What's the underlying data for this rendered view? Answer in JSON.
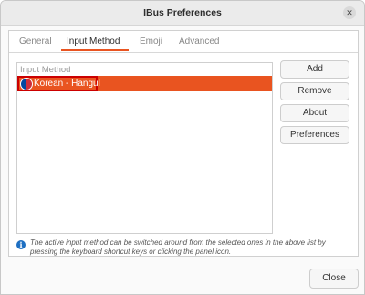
{
  "window": {
    "title": "IBus Preferences",
    "close_glyph": "✕"
  },
  "tabs": [
    {
      "label": "General",
      "active": false
    },
    {
      "label": "Input Method",
      "active": true
    },
    {
      "label": "Emoji",
      "active": false
    },
    {
      "label": "Advanced",
      "active": false
    }
  ],
  "input_methods": {
    "header": "Input Method",
    "items": [
      {
        "label": "Korean - Hangul",
        "icon": "korean-flag-icon",
        "selected": true
      }
    ]
  },
  "buttons": {
    "add": "Add",
    "remove": "Remove",
    "about": "About",
    "preferences": "Preferences"
  },
  "info": {
    "icon_glyph": "i",
    "text": "The active input method can be switched around from the selected ones in the above list by pressing the keyboard shortcut keys or clicking the panel icon."
  },
  "footer": {
    "close": "Close"
  },
  "colors": {
    "accent": "#e95420",
    "highlight_border": "#cc0000",
    "info_icon": "#1e6fc2"
  }
}
